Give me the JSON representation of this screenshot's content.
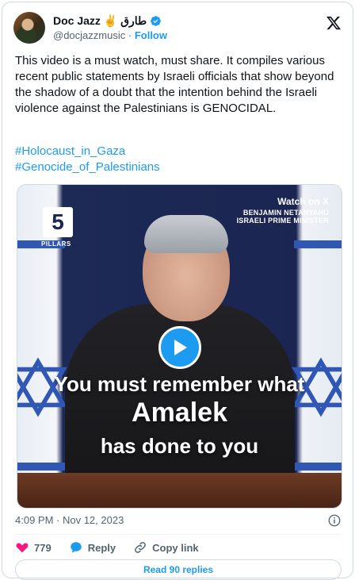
{
  "author": {
    "name": "Doc Jazz ✌️ طارق",
    "handle": "@docjazzmusic",
    "separator": "·",
    "follow_label": "Follow"
  },
  "tweet": {
    "text": "This video is a must watch, must share. It compiles various recent public statements by Israeli officials that show beyond the shadow of a doubt that the intention behind the Israeli violence against the Palestinians is GENOCIDAL.",
    "hashtags": [
      "#Holocaust_in_Gaza",
      "#Genocide_of_Palestinians"
    ]
  },
  "media": {
    "watch_label": "Watch on X",
    "nameplate_line1": "BENJAMIN NETANYAHU",
    "nameplate_line2": "ISRAELI PRIME MINISTER",
    "logo_number": "5",
    "logo_text": "PILLARS",
    "caption_line1": "You must remember what",
    "caption_line2": "Amalek",
    "caption_line3": "has done to you"
  },
  "meta": {
    "timestamp": "4:09 PM · Nov 12, 2023"
  },
  "actions": {
    "likes": "779",
    "reply_label": "Reply",
    "copy_label": "Copy link",
    "read_replies_label": "Read 90 replies"
  },
  "colors": {
    "accent": "#1d9bf0",
    "like": "#f91880",
    "text": "#0f1419",
    "muted": "#536471"
  }
}
